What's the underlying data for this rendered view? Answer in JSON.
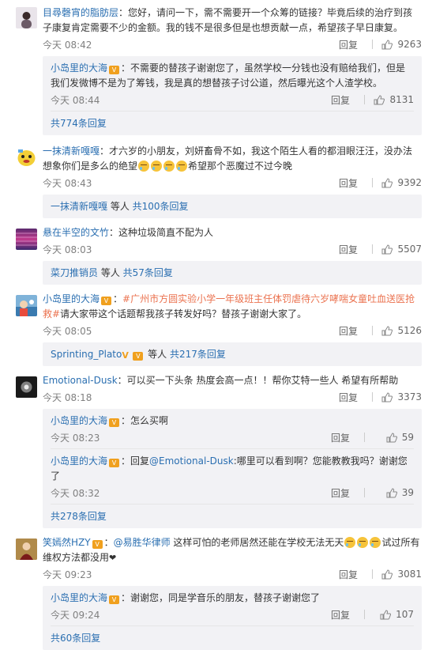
{
  "ui": {
    "reply_label": "回复"
  },
  "c1": {
    "user": "目尋磬宵的脂肪层",
    "text": "：您好，请问一下，需不需要开一个众筹的链接？毕竟后续的治疗到孩子康复肯定需要不少的金额。我的钱不是很多但是也想贡献一点，希望孩子早日康复。",
    "time": "今天 08:42",
    "likes": "9263",
    "replies": [
      {
        "user": "小岛里的大海",
        "text": "：不需要的替孩子谢谢您了，虽然学校一分钱也没有赔给我们，但是我们发微博不是为了筹钱，我是真的想替孩子讨公道，然后曝光这个人渣学校。",
        "time": "今天 08:44",
        "likes": "8131"
      }
    ],
    "more": "共774条回复"
  },
  "c2": {
    "user": "一抹清新嘎嘎",
    "text_a": "：才六岁的小朋友，刘妍畜骨不如，我这个陌生人看的都泪眼汪汪，没办法想象你们是多么的绝望",
    "text_b": "希望那个恶魔过不过今晚",
    "time": "今天 08:43",
    "likes": "9392",
    "more_user": "一抹清新嘎嘎",
    "more_mid": " 等人 ",
    "more_count": "共100条回复"
  },
  "c3": {
    "user": "悬在半空的文竹",
    "text": "：这种垃圾简直不配为人",
    "time": "今天 08:03",
    "likes": "5507",
    "more_user": "菜刀推销员",
    "more_mid": " 等人 ",
    "more_count": "共57条回复"
  },
  "c4": {
    "user": "小岛里的大海",
    "topic": "#广州市方圆实验小学一年级班主任体罚虐待六岁哮喘女童吐血送医抢救#",
    "text": "请大家带这个话题帮我孩子转发好吗？替孩子谢谢大家了。",
    "time": "今天 08:05",
    "likes": "5126",
    "more_user": "Sprinting_Plato",
    "more_mid": " 等人 ",
    "more_count": "共217条回复"
  },
  "c5": {
    "user": "Emotional-Dusk",
    "text": "：可以买一下头条  热度会高一点！！帮你艾特一些人 希望有所帮助",
    "time": "今天 08:18",
    "likes": "3373",
    "replies": [
      {
        "user": "小岛里的大海",
        "text": "：怎么买啊",
        "time": "今天 08:23",
        "likes": "59"
      },
      {
        "user": "小岛里的大海",
        "pre": "：回复",
        "mention": "@Emotional-Dusk",
        "text": ":哪里可以看到啊？您能教教我吗？谢谢您了",
        "time": "今天 08:32",
        "likes": "39"
      }
    ],
    "more": "共278条回复"
  },
  "c6": {
    "user": "笑嫣然HZY",
    "pre": "：",
    "mention": "@易胜华律师",
    "text_a": " 这样可怕的老师居然还能在学校无法无天",
    "text_b": "试过所有维权方法都没用",
    "time": "今天 09:23",
    "likes": "3081",
    "replies": [
      {
        "user": "小岛里的大海",
        "text": "：谢谢您，同是学音乐的朋友，替孩子谢谢您了",
        "time": "今天 09:24",
        "likes": "107"
      }
    ],
    "more": "共60条回复"
  },
  "colors": {
    "link": "#2b6fb1",
    "highlight": "#eb7350",
    "reply_bg": "#f2f2f5"
  }
}
